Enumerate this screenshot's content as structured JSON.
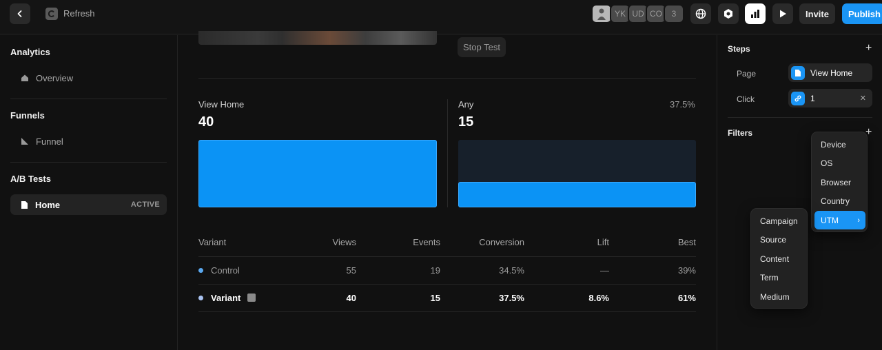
{
  "topbar": {
    "app_title": "Refresh",
    "avatars": [
      "YK",
      "UD",
      "CO",
      "3"
    ],
    "invite_label": "Invite",
    "publish_label": "Publish"
  },
  "sidebar": {
    "sections": [
      {
        "title": "Analytics",
        "items": [
          {
            "label": "Overview"
          }
        ]
      },
      {
        "title": "Funnels",
        "items": [
          {
            "label": "Funnel"
          }
        ]
      },
      {
        "title": "A/B Tests",
        "items": [
          {
            "label": "Home",
            "badge": "ACTIVE"
          }
        ]
      }
    ]
  },
  "main": {
    "stop_label": "Stop Test",
    "cards": [
      {
        "label": "View Home",
        "value": "40",
        "pct": "",
        "fill": 1.0
      },
      {
        "label": "Any",
        "value": "15",
        "pct": "37.5%",
        "fill": 0.375
      }
    ],
    "table": {
      "headers": [
        "Variant",
        "Views",
        "Events",
        "Conversion",
        "Lift",
        "Best"
      ],
      "rows": [
        {
          "name": "Control",
          "views": "55",
          "events": "19",
          "conversion": "34.5%",
          "lift": "—",
          "best": "39%"
        },
        {
          "name": "Variant",
          "views": "40",
          "events": "15",
          "conversion": "37.5%",
          "lift": "8.6%",
          "best": "61%"
        }
      ]
    }
  },
  "right_panel": {
    "steps_title": "Steps",
    "steps": [
      {
        "key": "Page",
        "value": "View Home"
      },
      {
        "key": "Click",
        "value": "1"
      }
    ],
    "filters_title": "Filters",
    "filter_menu": [
      "Device",
      "OS",
      "Browser",
      "Country",
      "UTM"
    ],
    "utm_submenu": [
      "Campaign",
      "Source",
      "Content",
      "Term",
      "Medium"
    ]
  },
  "colors": {
    "accent": "#1a95f5",
    "bar_track": "#17202b",
    "background": "#111111"
  }
}
